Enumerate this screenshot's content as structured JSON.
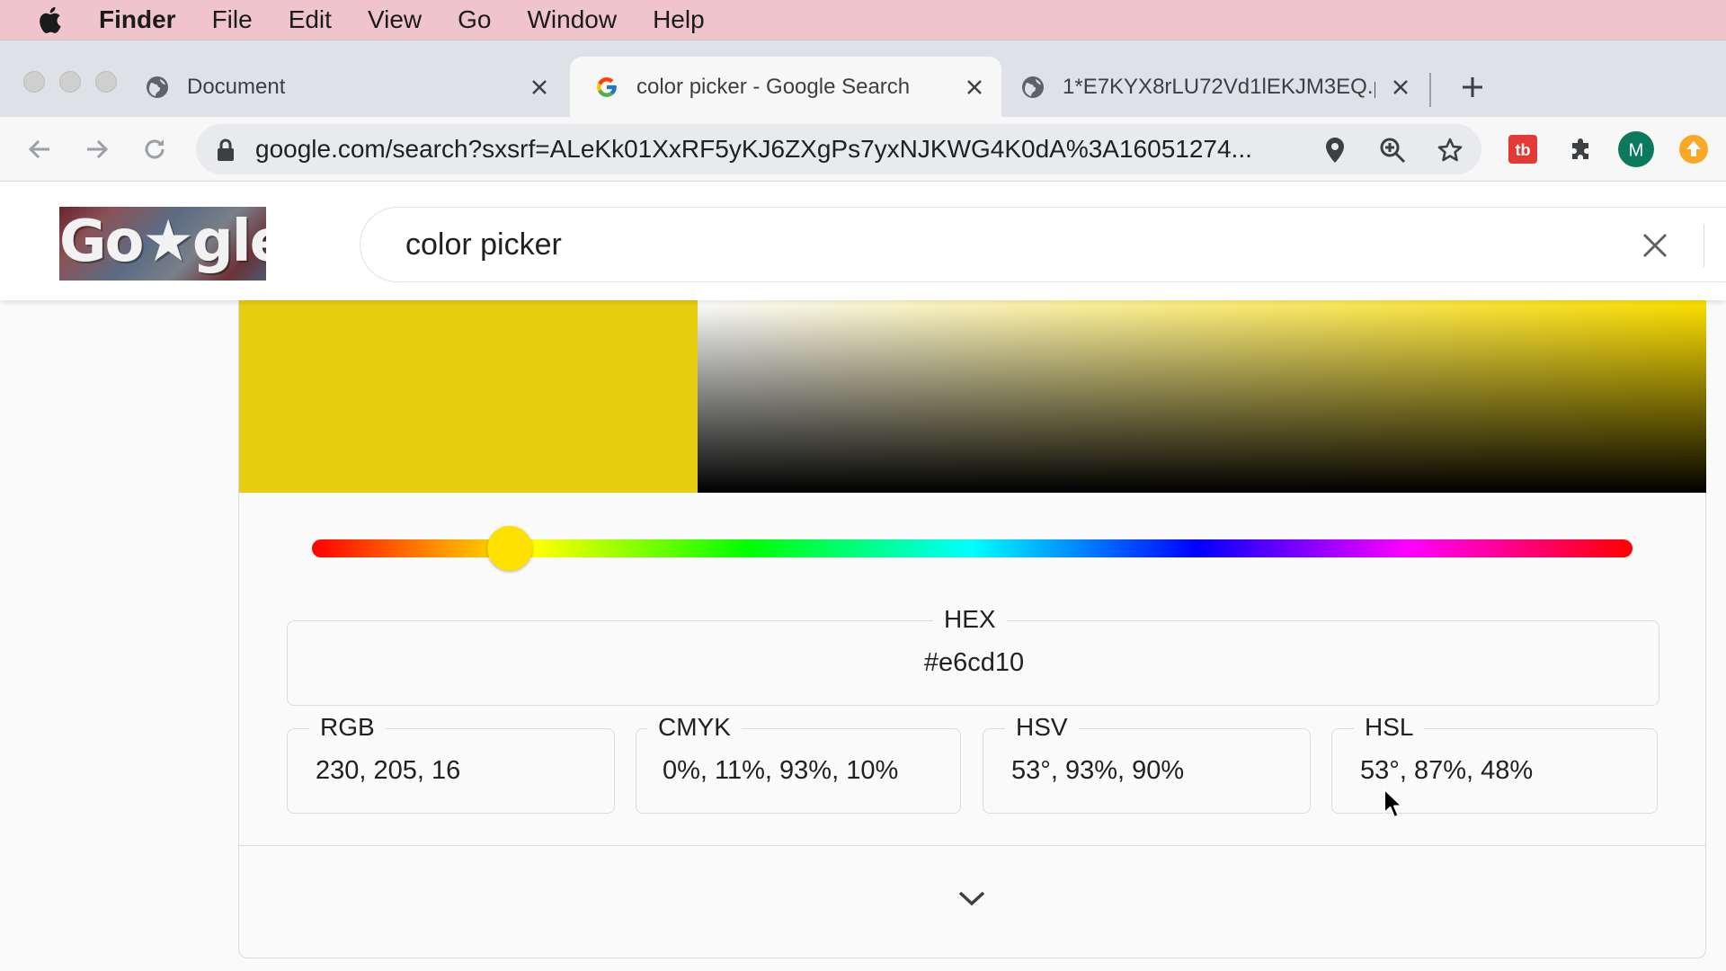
{
  "menubar": {
    "app": "Finder",
    "items": [
      "File",
      "Edit",
      "View",
      "Go",
      "Window",
      "Help"
    ]
  },
  "tabs": [
    {
      "title": "Document",
      "icon": "globe-icon",
      "active": false
    },
    {
      "title": "color picker - Google Search",
      "icon": "google-g-icon",
      "active": true
    },
    {
      "title": "1*E7KYX8rLU72Vd1lEKJM3EQ.png",
      "icon": "globe-icon",
      "active": false
    }
  ],
  "address_bar": {
    "url": "google.com/search?sxsrf=ALeKk01XxRF5yKJ6ZXgPs7yxNJKWG4K0dA%3A16051274..."
  },
  "profile": {
    "initial": "M",
    "color": "#0b7a5c"
  },
  "google": {
    "logo_text": "Go★gle",
    "query": "color picker"
  },
  "color_picker": {
    "selected_color": "#e6cd10",
    "hue_degrees": 53,
    "hue_fraction": 0.15,
    "hex": {
      "label": "HEX",
      "value": "#e6cd10"
    },
    "rgb": {
      "label": "RGB",
      "value": "230, 205, 16"
    },
    "cmyk": {
      "label": "CMYK",
      "value": "0%, 11%, 93%, 10%"
    },
    "hsv": {
      "label": "HSV",
      "value": "53°, 93%, 90%"
    },
    "hsl": {
      "label": "HSL",
      "value": "53°, 87%, 48%"
    }
  },
  "colors": {
    "menubar_bg": "#efc4cd",
    "hue_pure": "#ffe100",
    "extension_red": "#e53935",
    "extension_orange": "#f9a825"
  }
}
